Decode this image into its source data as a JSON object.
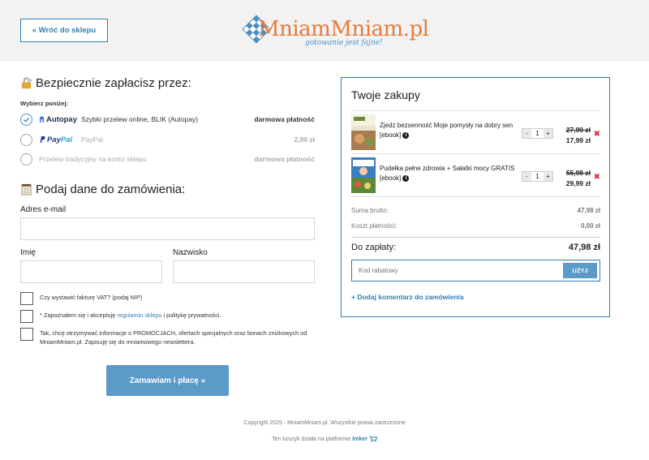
{
  "header": {
    "back_label": "« Wróć do sklepu",
    "logo_text": "MniamMniam.pl",
    "logo_tagline": "gotowanie jest fajne!"
  },
  "payment": {
    "title": "Bezpiecznie zapłacisz przez:",
    "choose_label": "Wybierz poniżej:",
    "methods": [
      {
        "logo": "Autopay",
        "desc": "Szybki przelew online, BLIK (Autopay)",
        "price": "darmowa płatność",
        "selected": true
      },
      {
        "logo": "PayPal",
        "desc": "PayPal",
        "price": "2,99 zł",
        "selected": false
      },
      {
        "logo": "",
        "desc": "Przelew tradycyjny na konto sklepu",
        "price": "darmowa płatność",
        "selected": false
      }
    ]
  },
  "order_form": {
    "title": "Podaj dane do zamówienia:",
    "email_label": "Adres e-mail",
    "email_value": "",
    "first_name_label": "Imię",
    "first_name_value": "",
    "last_name_label": "Nazwisko",
    "last_name_value": "",
    "invoice_label": "Czy wystawić fakturę VAT? (podaj NIP)",
    "terms_prefix": "* Zapoznałem się i akceptuję ",
    "terms_link": "regulamin sklepu",
    "terms_suffix": " i politykę prywatności.",
    "newsletter_label": "Tak, chcę otrzymywać informacje o PROMOCJACH, ofertach specjalnych oraz bonach zniżkowych od MniamMniam.pl. Zapisuję się do mniamowego newslettera.",
    "submit_label": "Zamawiam i płacę »"
  },
  "cart": {
    "title": "Twoje zakupy",
    "items": [
      {
        "name": "Zjedz bezsenność Moje pomysły na dobry sen [ebook]",
        "qty": "1",
        "old_price": "27,99 zł",
        "price": "17,99 zł"
      },
      {
        "name": "Pudełka pełne zdrowia + Sałatki mocy GRATIS [ebook]",
        "qty": "1",
        "old_price": "55,98 zł",
        "price": "29,99 zł"
      }
    ],
    "qty_minus": "-",
    "qty_plus": "+",
    "remove_symbol": "✖",
    "gross_label": "Suma brutto:",
    "gross_value": "47,98 zł",
    "payment_cost_label": "Koszt płatności:",
    "payment_cost_value": "0,00 zł",
    "total_label": "Do zapłaty:",
    "total_value": "47,98 zł",
    "coupon_placeholder": "Kod rabatowy",
    "coupon_button": "UŻYJ",
    "add_comment": "+ Dodaj komentarz do zamówienia"
  },
  "footer": {
    "copyright": "Copyright 2025 - MniamMniam.pl. Wszystkie prawa zastrzeżone",
    "platform_prefix": "Ten koszyk działa na platformie ",
    "platform_link": "Imker"
  },
  "colors": {
    "accent": "#2f7fb4",
    "button": "#5b9ac9",
    "logo_orange": "#e87a3c",
    "remove_red": "#d0303a"
  }
}
